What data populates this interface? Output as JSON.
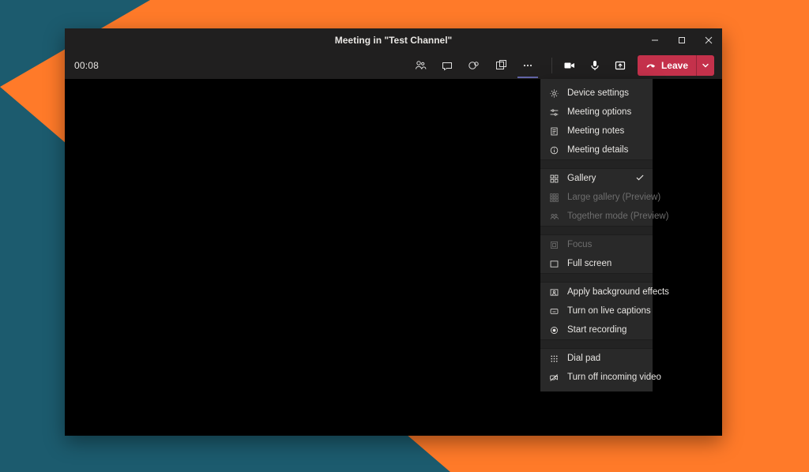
{
  "window": {
    "title": "Meeting in \"Test Channel\""
  },
  "toolbar": {
    "timer": "00:08",
    "leave_label": "Leave"
  },
  "menu": {
    "device_settings": "Device settings",
    "meeting_options": "Meeting options",
    "meeting_notes": "Meeting notes",
    "meeting_details": "Meeting details",
    "gallery": "Gallery",
    "large_gallery": "Large gallery (Preview)",
    "together_mode": "Together mode (Preview)",
    "focus": "Focus",
    "full_screen": "Full screen",
    "apply_bg": "Apply background effects",
    "live_captions": "Turn on live captions",
    "start_recording": "Start recording",
    "dial_pad": "Dial pad",
    "turn_off_incoming": "Turn off incoming video"
  },
  "colors": {
    "bg_orange": "#ff7a29",
    "bg_teal": "#1c5b6e",
    "accent": "#6264a7",
    "danger": "#c4314b",
    "panel": "#201f1f",
    "menu": "#292929"
  }
}
